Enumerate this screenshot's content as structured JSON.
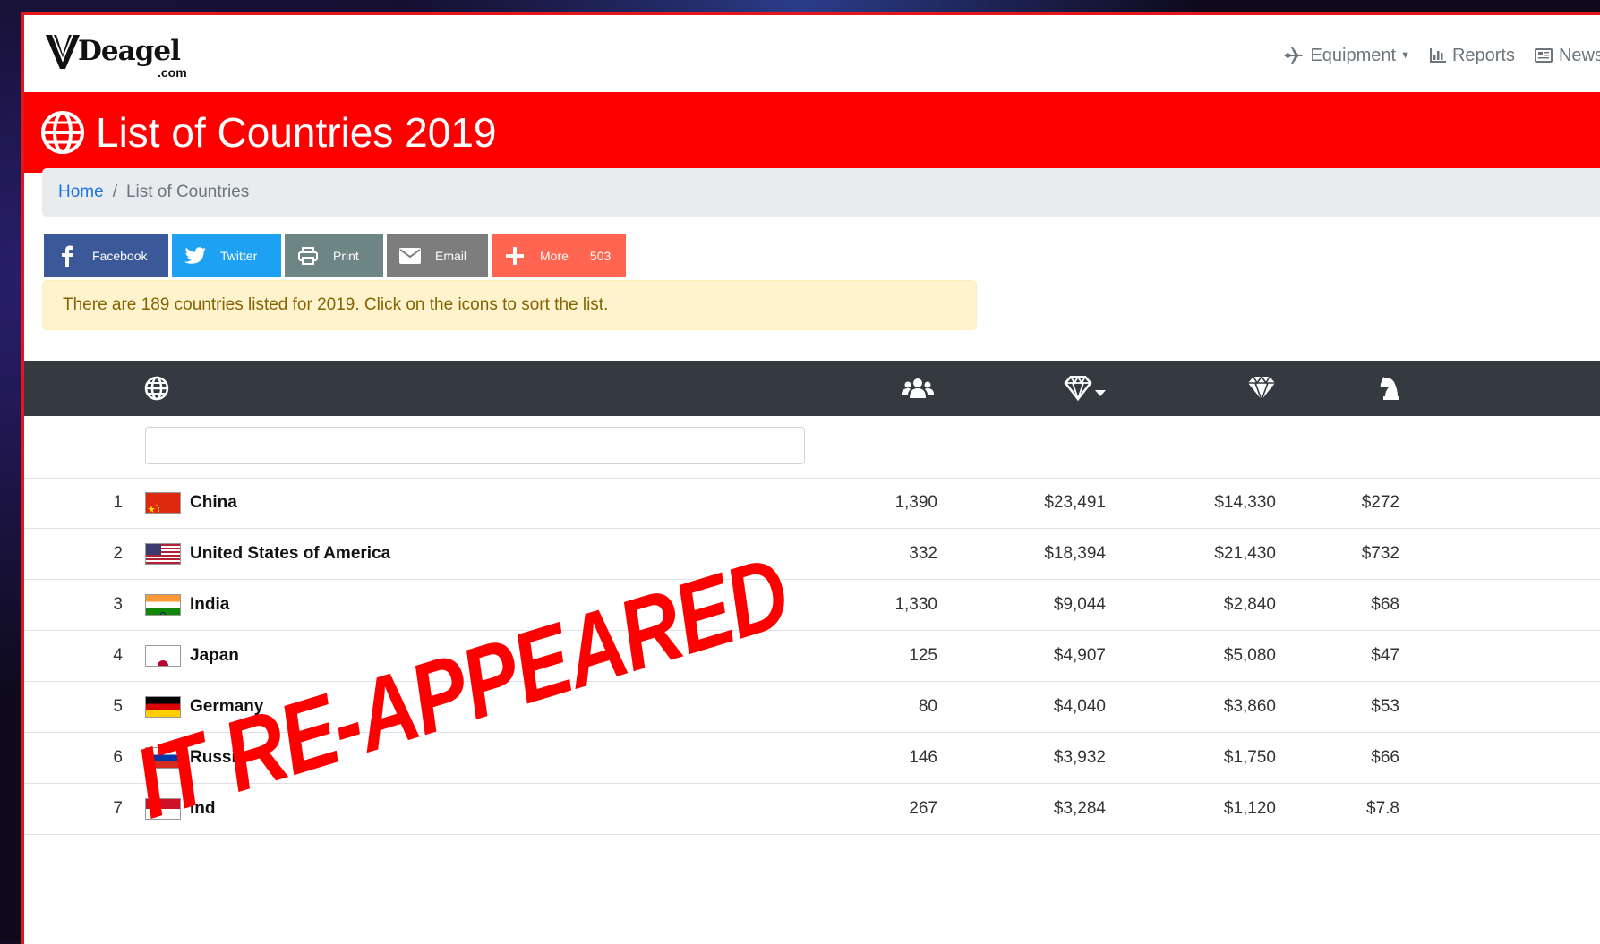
{
  "navbar": {
    "logo_text": "Deagel",
    "logo_suffix": ".com",
    "links": [
      {
        "label": "Equipment",
        "icon": "airplane-icon",
        "has_dropdown": true
      },
      {
        "label": "Reports",
        "icon": "bar-chart-icon",
        "has_dropdown": false
      },
      {
        "label": "News",
        "icon": "newspaper-icon",
        "has_dropdown": false
      }
    ]
  },
  "header": {
    "title": "List of Countries 2019",
    "icon": "globe-icon",
    "bg_color": "#ff0000"
  },
  "breadcrumb": {
    "home": "Home",
    "separator": "/",
    "current": "List of Countries"
  },
  "share": {
    "facebook": "Facebook",
    "twitter": "Twitter",
    "print": "Print",
    "email": "Email",
    "more": "More",
    "more_count": "503"
  },
  "alert": {
    "text": "There are 189 countries listed for 2019. Click on the icons to sort the list."
  },
  "table": {
    "header_icons": [
      "globe-icon",
      "users-icon",
      "diamond-sort-icon",
      "diamond-icon",
      "chess-knight-icon"
    ],
    "rows": [
      {
        "rank": "1",
        "country": "China",
        "flag": "china-flag",
        "population": "1,390",
        "gdp_ppp": "$23,491",
        "gdp": "$14,330",
        "military": "$272"
      },
      {
        "rank": "2",
        "country": "United States of America",
        "flag": "usa-flag",
        "population": "332",
        "gdp_ppp": "$18,394",
        "gdp": "$21,430",
        "military": "$732"
      },
      {
        "rank": "3",
        "country": "India",
        "flag": "india-flag",
        "population": "1,330",
        "gdp_ppp": "$9,044",
        "gdp": "$2,840",
        "military": "$68"
      },
      {
        "rank": "4",
        "country": "Japan",
        "flag": "japan-flag",
        "population": "125",
        "gdp_ppp": "$4,907",
        "gdp": "$5,080",
        "military": "$47"
      },
      {
        "rank": "5",
        "country": "Germany",
        "flag": "germany-flag",
        "population": "80",
        "gdp_ppp": "$4,040",
        "gdp": "$3,860",
        "military": "$53"
      },
      {
        "rank": "6",
        "country": "Russia",
        "flag": "russia-flag",
        "population": "146",
        "gdp_ppp": "$3,932",
        "gdp": "$1,750",
        "military": "$66"
      },
      {
        "rank": "7",
        "country": "Ind",
        "flag": "indonesia-flag",
        "population": "267",
        "gdp_ppp": "$3,284",
        "gdp": "$1,120",
        "military": "$7.8"
      }
    ]
  },
  "overlay": {
    "text": "IT RE-APPEARED",
    "color": "#ff0000"
  }
}
